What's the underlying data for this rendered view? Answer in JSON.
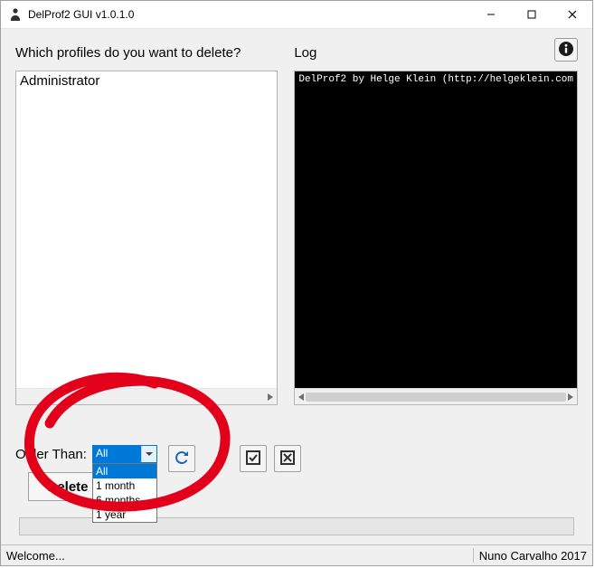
{
  "window": {
    "title": "DelProf2 GUI v1.0.1.0"
  },
  "left": {
    "heading": "Which profiles do you want to delete?",
    "profiles": [
      "Administrator"
    ]
  },
  "right": {
    "heading": "Log",
    "console_line": "DelProf2 by Helge Klein (http://helgeklein.com"
  },
  "controls": {
    "older_than_label": "Older Than:",
    "selected": "All",
    "options": [
      "All",
      "1 month",
      "6 months",
      "1 year"
    ],
    "delete_label": "Delete"
  },
  "statusbar": {
    "left": "Welcome...",
    "right": "Nuno Carvalho 2017"
  }
}
